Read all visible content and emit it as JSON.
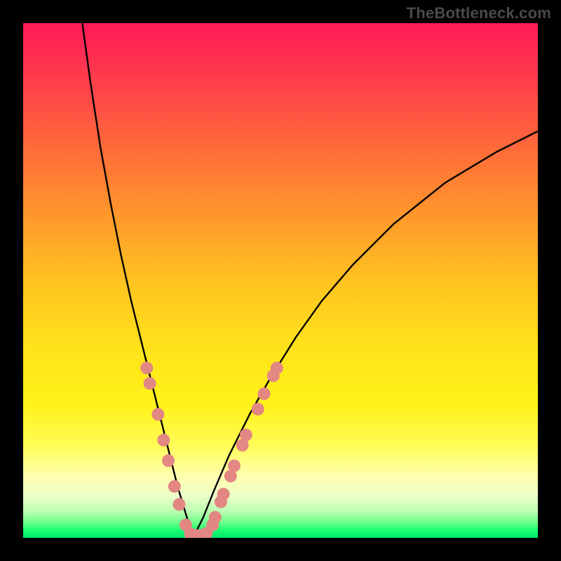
{
  "watermark": "TheBottleneck.com",
  "colors": {
    "dot": "#e38783",
    "curve": "#000000",
    "background_frame": "#000000"
  },
  "chart_data": {
    "type": "line",
    "title": "",
    "xlabel": "",
    "ylabel": "",
    "xlim": [
      0,
      100
    ],
    "ylim": [
      0,
      100
    ],
    "grid": false,
    "legend": false,
    "series": [
      {
        "name": "curve-left",
        "x": [
          11.5,
          13,
          15,
          17,
          19,
          21,
          23,
          25,
          27,
          28.5,
          30,
          31.5,
          33
        ],
        "y": [
          100,
          89,
          76,
          65,
          55,
          46,
          38,
          30,
          22,
          16,
          10,
          5,
          0
        ]
      },
      {
        "name": "curve-right",
        "x": [
          33,
          35,
          37,
          40,
          44,
          48,
          53,
          58,
          64,
          72,
          82,
          92,
          100
        ],
        "y": [
          0,
          4,
          9,
          16,
          24,
          31,
          39,
          46,
          53,
          61,
          69,
          75,
          79
        ]
      }
    ],
    "annotations": {
      "dots": [
        {
          "x": 24.0,
          "y": 33
        },
        {
          "x": 24.6,
          "y": 30
        },
        {
          "x": 26.2,
          "y": 24
        },
        {
          "x": 27.3,
          "y": 19
        },
        {
          "x": 28.2,
          "y": 15
        },
        {
          "x": 29.4,
          "y": 10
        },
        {
          "x": 30.3,
          "y": 6.5
        },
        {
          "x": 31.6,
          "y": 2.5
        },
        {
          "x": 32.5,
          "y": 0.8
        },
        {
          "x": 33.5,
          "y": 0.5
        },
        {
          "x": 34.6,
          "y": 0.5
        },
        {
          "x": 35.6,
          "y": 0.9
        },
        {
          "x": 36.8,
          "y": 2.5
        },
        {
          "x": 37.3,
          "y": 4
        },
        {
          "x": 38.4,
          "y": 7
        },
        {
          "x": 38.9,
          "y": 8.5
        },
        {
          "x": 40.3,
          "y": 12
        },
        {
          "x": 41.0,
          "y": 14
        },
        {
          "x": 42.6,
          "y": 18
        },
        {
          "x": 43.3,
          "y": 20
        },
        {
          "x": 45.6,
          "y": 25
        },
        {
          "x": 46.8,
          "y": 28
        },
        {
          "x": 48.6,
          "y": 31.5
        },
        {
          "x": 49.3,
          "y": 33
        }
      ]
    }
  }
}
